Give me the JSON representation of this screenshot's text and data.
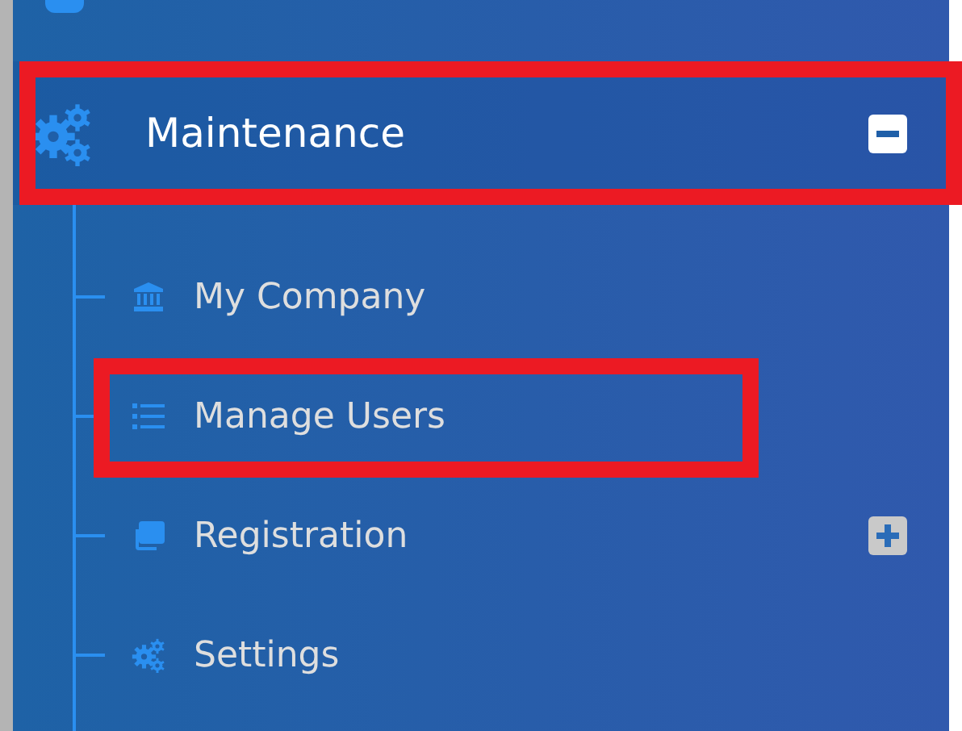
{
  "menu": {
    "label": "Maintenance",
    "expanded": true,
    "highlighted": true,
    "children": [
      {
        "label": "My Company",
        "kind": "bank"
      },
      {
        "label": "Manage Users",
        "kind": "list",
        "highlighted": true
      },
      {
        "label": "Registration",
        "kind": "copies",
        "expanded": false
      },
      {
        "label": "Settings",
        "kind": "gears"
      }
    ]
  }
}
